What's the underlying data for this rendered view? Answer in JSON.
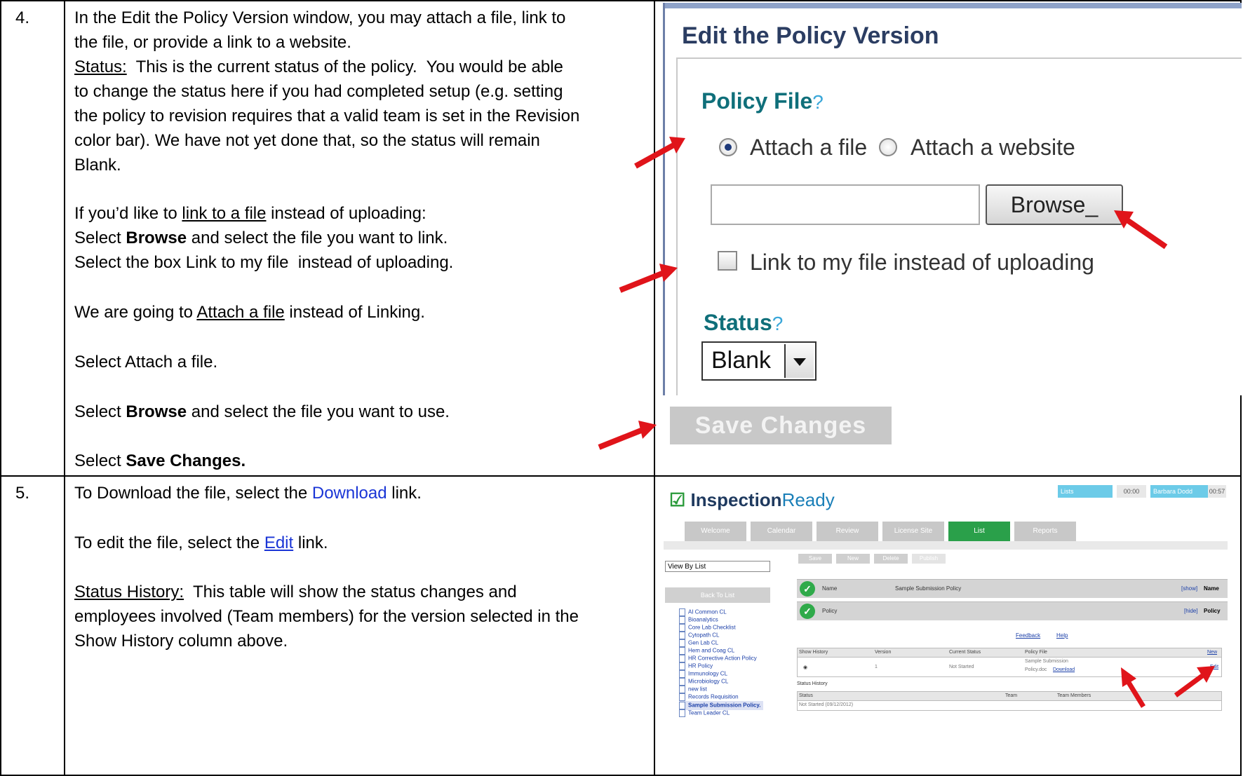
{
  "steps": [
    {
      "number": "4.",
      "lines": {
        "l1": "In the Edit the Policy Version window, you may attach a file, link to",
        "l2": "the file, or provide a link to a website.",
        "l3_label": "Status:",
        "l3_rest": "  This is the current status of the policy.  You would be able",
        "l4": "to change the status here if you had completed setup (e.g. setting",
        "l5": "the policy to revision requires that a valid team is set in the Revision",
        "l6": "color bar). We have not yet done that, so the status will remain",
        "l7": "Blank.",
        "l8_pre": "If you’d like to ",
        "l8_link": "link to a file",
        "l8_post": " instead of uploading:",
        "l9_pre": "Select ",
        "l9_bold": "Browse",
        "l9_post": " and select the file you want to link.",
        "l10": "Select the box Link to my file  instead of uploading.",
        "l11_pre": "We are going to ",
        "l11_link": "Attach a file",
        "l11_post": " instead of Linking.",
        "l12": "Select Attach a file.",
        "l13_pre": "Select ",
        "l13_bold": "Browse",
        "l13_post": " and select the file you want to use.",
        "l14_pre": "Select ",
        "l14_bold": "Save Changes."
      }
    },
    {
      "number": "5.",
      "lines": {
        "l1_pre": "To Download the file, select the ",
        "l1_link": "Download",
        "l1_post": " link.",
        "l2_pre": "To edit the file, select the ",
        "l2_link": "Edit",
        "l2_post": " link.",
        "l3_label": "Status History:",
        "l3_rest": "  This table will show the status changes and",
        "l4": "employees involved (Team members) for the version selected in the",
        "l5": "Show History column above."
      }
    }
  ],
  "edit_dialog": {
    "title": "Edit the Policy Version",
    "policy_file_label": "Policy File",
    "help_mark": "?",
    "attach_file_label": "Attach a file",
    "attach_website_label": "Attach a website",
    "attach_file_selected": true,
    "file_input_value": "",
    "browse_label": "Browse_",
    "link_checkbox_label": "Link to my file instead of uploading",
    "link_checkbox_checked": false,
    "status_label": "Status",
    "status_value": "Blank",
    "save_label": "Save Changes"
  },
  "inspection_app": {
    "logo_check": "☑",
    "logo_bold": "Inspection",
    "logo_rest": "Ready",
    "top": {
      "lists": "Lists",
      "time1": "00:00",
      "user": "Barbara Dodd",
      "time2": "00:57"
    },
    "nav_tabs": [
      "Welcome",
      "Calendar",
      "Review",
      "License Site",
      "List",
      "Reports"
    ],
    "active_tab": "List",
    "sidebar": {
      "view_select": "View By List",
      "back": "Back To List",
      "items": [
        "AI Common CL",
        "Bioanalytics",
        "Core Lab Checklist",
        "Cytopath CL",
        "Gen Lab CL",
        "Hem and Coag CL",
        "HR Corrective Action Policy",
        "HR Policy",
        "Immunology CL",
        "Microbiology CL",
        "new list",
        "Records Requisition",
        "Sample Submission Policy.",
        "Team Leader CL"
      ],
      "current": "Sample Submission Policy."
    },
    "toolbar": [
      "Save",
      "New",
      "Delete",
      "Publish"
    ],
    "name_row": {
      "label": "Name",
      "value": "Sample Submission Policy",
      "toggle": "[show]",
      "right": "Name"
    },
    "policy_row": {
      "label": "Policy",
      "toggle": "[hide]",
      "right": "Policy"
    },
    "feedback_link": "Feedback",
    "help_link": "Help",
    "policy_table": {
      "headers": [
        "Show History",
        "Version",
        "Current Status",
        "Policy File",
        "New"
      ],
      "row": {
        "version": "1",
        "status": "Not Started",
        "file_line1": "Sample Submission",
        "file_line2": "Policy.doc",
        "download": "Download",
        "edit": "Edit"
      }
    },
    "status_history_label": "Status History",
    "history_table": {
      "headers": [
        "Status",
        "Team",
        "Team Members"
      ],
      "row": {
        "status": "Not Started (09/12/2012)"
      }
    }
  },
  "colors": {
    "arrow": "#e0141a",
    "link": "#1a35d6",
    "heading": "#0f6f7a",
    "active_tab": "#2aa04a"
  }
}
